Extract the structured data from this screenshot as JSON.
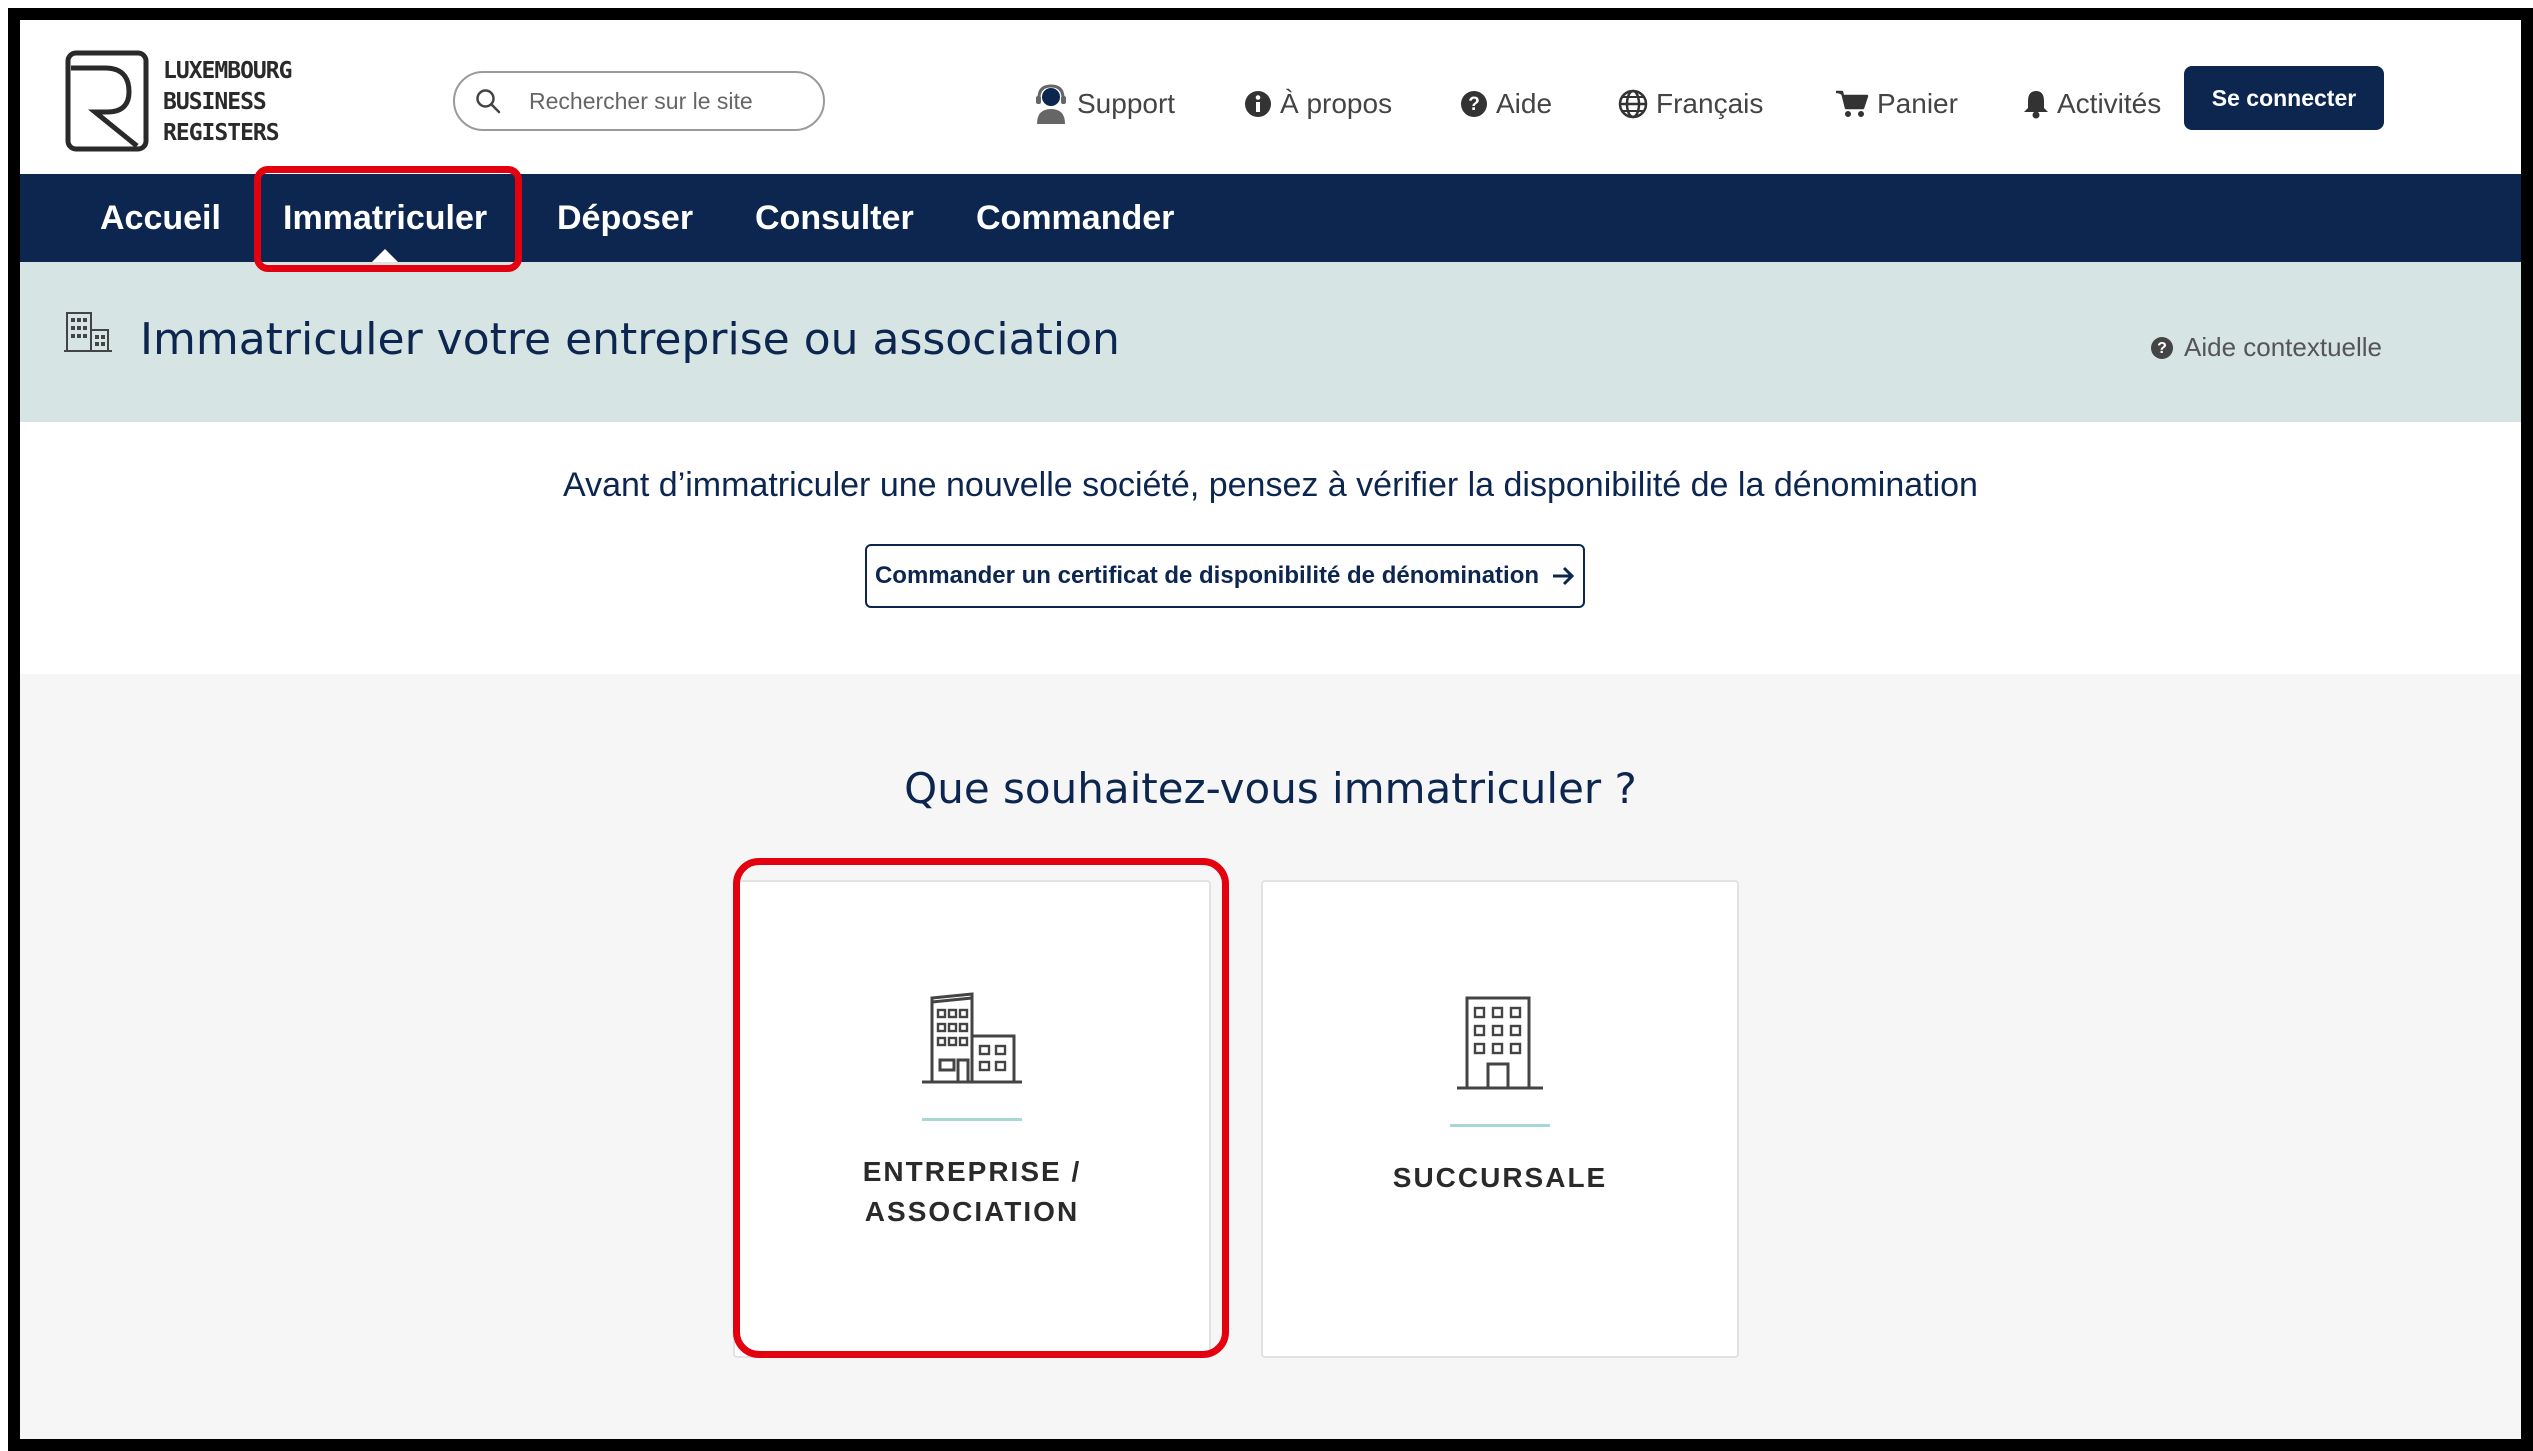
{
  "header": {
    "logo_lines": [
      "LUXEMBOURG",
      "BUSINESS",
      "REGISTERS"
    ],
    "search_placeholder": "Rechercher sur le site",
    "links": {
      "support": "Support",
      "about": "À propos",
      "help": "Aide",
      "language": "Français",
      "cart": "Panier",
      "activities": "Activités"
    },
    "login_label": "Se connecter"
  },
  "mainnav": {
    "tabs": [
      {
        "label": "Accueil"
      },
      {
        "label": "Immatriculer"
      },
      {
        "label": "Déposer"
      },
      {
        "label": "Consulter"
      },
      {
        "label": "Commander"
      }
    ],
    "active": "Immatriculer"
  },
  "band": {
    "title": "Immatriculer votre entreprise ou association",
    "help_label": "Aide contextuelle"
  },
  "notice": {
    "text": "Avant d’immatriculer une nouvelle société, pensez à vérifier la disponibilité de la dénomination",
    "button_label": "Commander un certificat de disponibilité de dénomination"
  },
  "choose": {
    "title": "Que souhaitez-vous immatriculer ?",
    "cards": [
      {
        "line1": "ENTREPRISE /",
        "line2": "ASSOCIATION",
        "icon": "buildings-icon"
      },
      {
        "line1": "SUCCURSALE",
        "icon": "building-icon"
      }
    ]
  },
  "colors": {
    "navy": "#0c2650",
    "band": "#d6e4e3",
    "highlight": "#e3000f",
    "accent_line": "#a8d8d6"
  }
}
